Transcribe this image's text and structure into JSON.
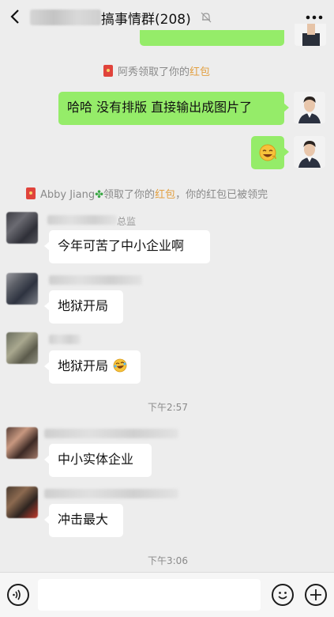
{
  "header": {
    "title": "搞事情群(208)"
  },
  "messages": {
    "sys_1": {
      "name": "阿秀",
      "text": "领取了你的",
      "highlight": "红包"
    },
    "out_1": {
      "text": "哈哈 没有排版 直接输出成图片了"
    },
    "sys_2": {
      "name": "Abby Jiang",
      "text": "领取了你的",
      "highlight": "红包",
      "suffix": "，你的红包已被领完"
    },
    "in_1": {
      "name_suffix": "总监",
      "text": "今年可苦了中小企业啊"
    },
    "in_2": {
      "text": "地狱开局"
    },
    "in_3": {
      "text": "地狱开局"
    },
    "time_1": "下午2:57",
    "in_4": {
      "text": "中小实体企业"
    },
    "in_5": {
      "text": "冲击最大"
    },
    "time_2": "下午3:06"
  },
  "colors": {
    "background": "#ededed",
    "outgoing_bubble": "#95ec69",
    "incoming_bubble": "#ffffff",
    "redpacket_highlight": "#e2a042"
  },
  "icons": [
    "back-icon",
    "mute-bell-icon",
    "more-icon",
    "redpacket-icon",
    "clover-emoji",
    "grin-emoji",
    "laugh-cry-emoji",
    "voice-icon",
    "emoji-icon",
    "plus-icon"
  ]
}
